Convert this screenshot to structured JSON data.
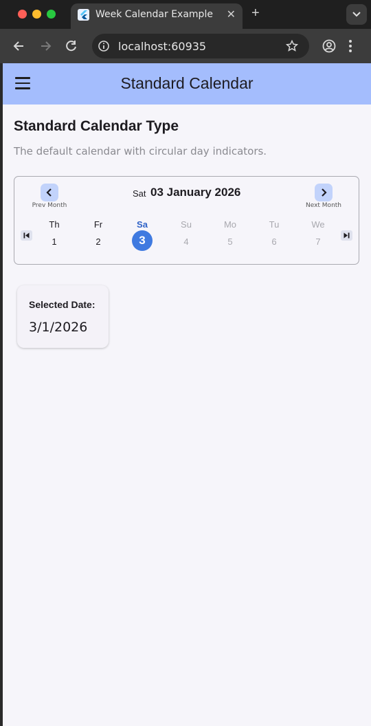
{
  "browser": {
    "tab_title": "Week Calendar Example",
    "tab_close": "✕",
    "new_tab": "+",
    "url": "localhost:60935"
  },
  "app_bar": {
    "title": "Standard Calendar"
  },
  "section": {
    "title": "Standard Calendar Type",
    "description": "The default calendar with circular day indicators."
  },
  "calendar": {
    "prev_label": "Prev Month",
    "next_label": "Next Month",
    "header_day": "Sat",
    "header_date": "03 January 2026",
    "days": [
      {
        "name": "Th",
        "num": "1",
        "state": "normal"
      },
      {
        "name": "Fr",
        "num": "2",
        "state": "normal"
      },
      {
        "name": "Sa",
        "num": "3",
        "state": "selected"
      },
      {
        "name": "Su",
        "num": "4",
        "state": "disabled"
      },
      {
        "name": "Mo",
        "num": "5",
        "state": "disabled"
      },
      {
        "name": "Tu",
        "num": "6",
        "state": "disabled"
      },
      {
        "name": "We",
        "num": "7",
        "state": "disabled"
      }
    ]
  },
  "selected": {
    "label": "Selected Date:",
    "value": "3/1/2026"
  },
  "colors": {
    "app_bar": "#a4bdfd",
    "selected_day": "#3f7ae0",
    "nav_button": "#c2d3fb"
  }
}
